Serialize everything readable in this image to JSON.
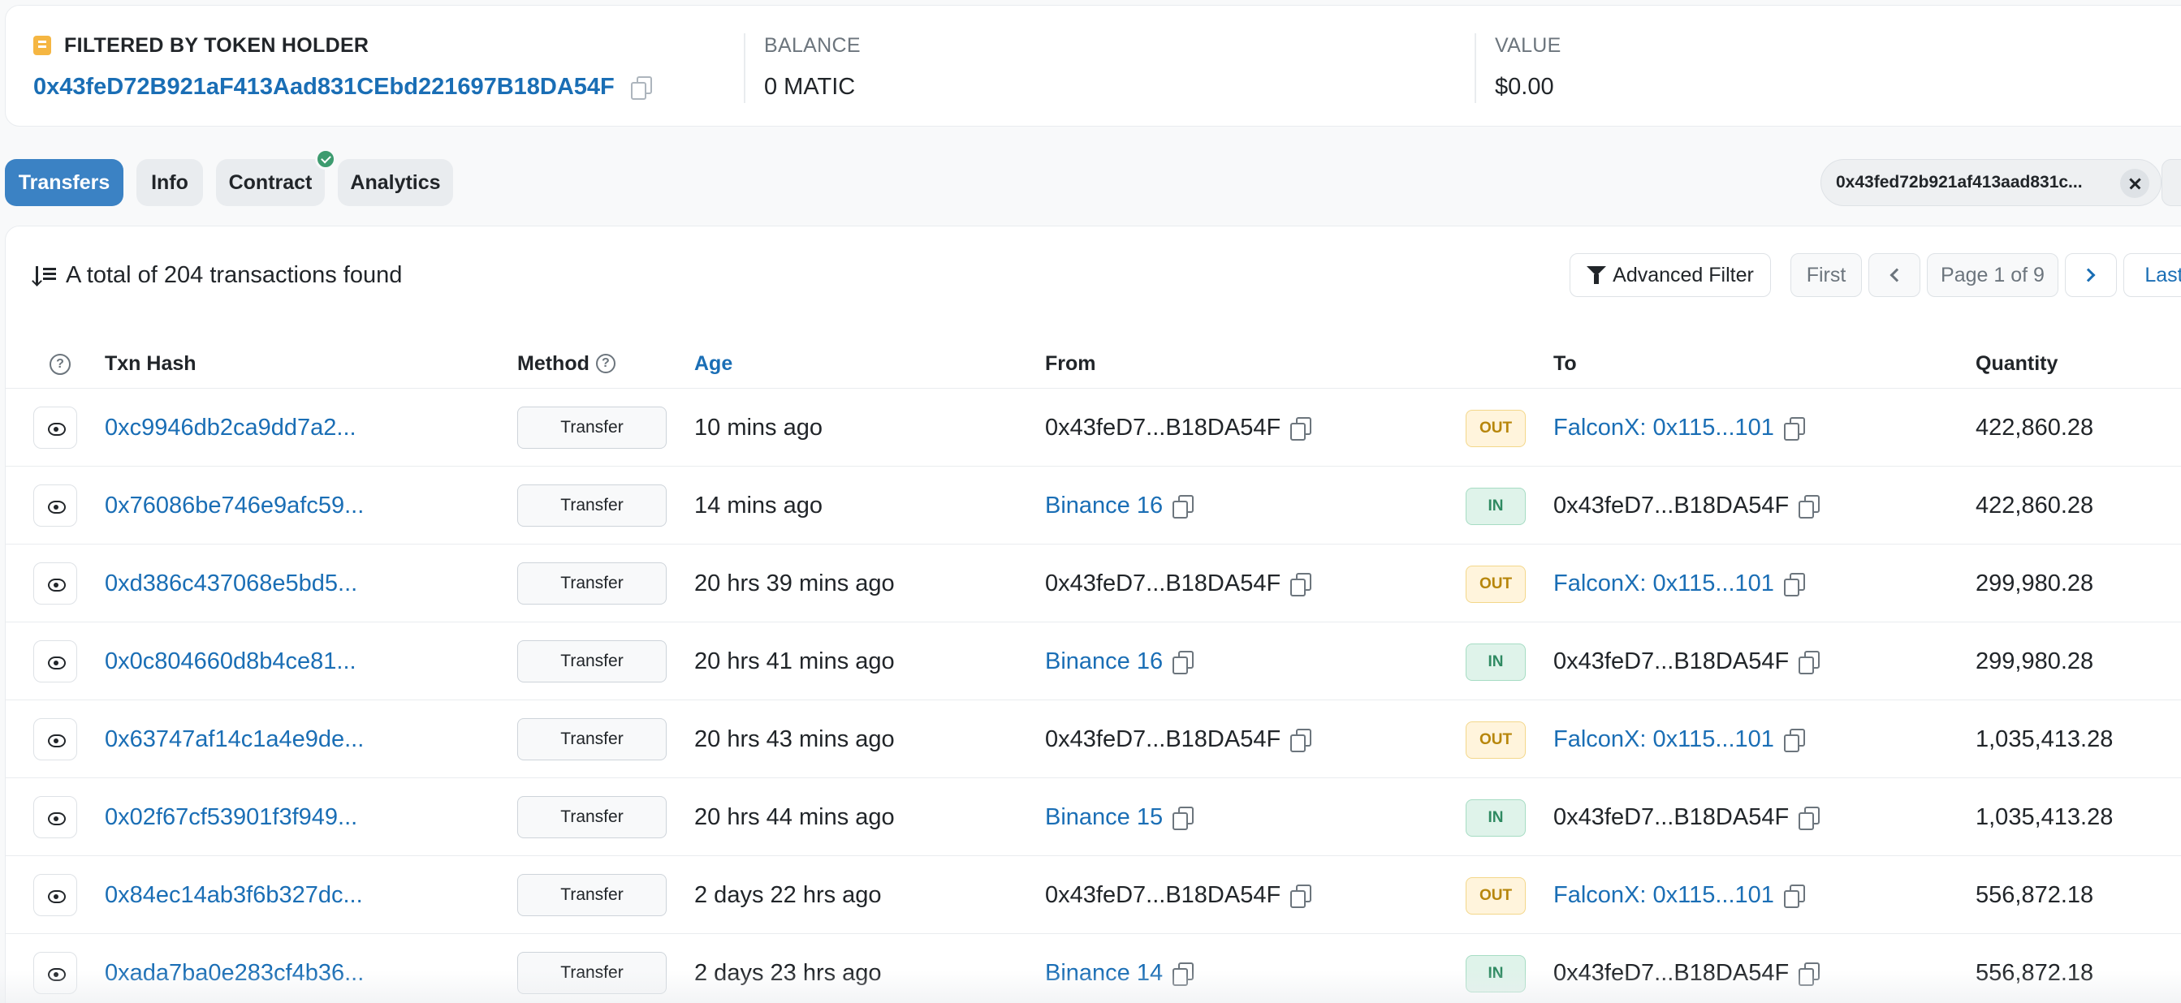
{
  "summary": {
    "holder_label": "FILTERED BY TOKEN HOLDER",
    "holder_address": "0x43feD72B921aF413Aad831CEbd221697B18DA54F",
    "balance_label": "BALANCE",
    "balance_value": "0 MATIC",
    "value_label": "VALUE",
    "value_value": "$0.00"
  },
  "tabs": [
    "Transfers",
    "Info",
    "Contract",
    "Analytics"
  ],
  "filter_chip": "0x43fed72b921af413aad831c...",
  "table": {
    "total_text": "A total of 204 transactions found",
    "advanced_filter": "Advanced Filter",
    "pager": {
      "first": "First",
      "page": "Page 1 of 9",
      "last": "Last"
    },
    "headers": {
      "hash": "Txn Hash",
      "method": "Method",
      "age": "Age",
      "from": "From",
      "to": "To",
      "quantity": "Quantity"
    },
    "rows": [
      {
        "hash": "0xc9946db2ca9dd7a2...",
        "method": "Transfer",
        "age": "10 mins ago",
        "from": "0x43feD7...B18DA54F",
        "from_link": false,
        "dir": "OUT",
        "to": "FalconX: 0x115...101",
        "to_link": true,
        "qty": "422,860.28"
      },
      {
        "hash": "0x76086be746e9afc59...",
        "method": "Transfer",
        "age": "14 mins ago",
        "from": "Binance 16",
        "from_link": true,
        "dir": "IN",
        "to": "0x43feD7...B18DA54F",
        "to_link": false,
        "qty": "422,860.28"
      },
      {
        "hash": "0xd386c437068e5bd5...",
        "method": "Transfer",
        "age": "20 hrs 39 mins ago",
        "from": "0x43feD7...B18DA54F",
        "from_link": false,
        "dir": "OUT",
        "to": "FalconX: 0x115...101",
        "to_link": true,
        "qty": "299,980.28"
      },
      {
        "hash": "0x0c804660d8b4ce81...",
        "method": "Transfer",
        "age": "20 hrs 41 mins ago",
        "from": "Binance 16",
        "from_link": true,
        "dir": "IN",
        "to": "0x43feD7...B18DA54F",
        "to_link": false,
        "qty": "299,980.28"
      },
      {
        "hash": "0x63747af14c1a4e9de...",
        "method": "Transfer",
        "age": "20 hrs 43 mins ago",
        "from": "0x43feD7...B18DA54F",
        "from_link": false,
        "dir": "OUT",
        "to": "FalconX: 0x115...101",
        "to_link": true,
        "qty": "1,035,413.28"
      },
      {
        "hash": "0x02f67cf53901f3f949...",
        "method": "Transfer",
        "age": "20 hrs 44 mins ago",
        "from": "Binance 15",
        "from_link": true,
        "dir": "IN",
        "to": "0x43feD7...B18DA54F",
        "to_link": false,
        "qty": "1,035,413.28"
      },
      {
        "hash": "0x84ec14ab3f6b327dc...",
        "method": "Transfer",
        "age": "2 days 22 hrs ago",
        "from": "0x43feD7...B18DA54F",
        "from_link": false,
        "dir": "OUT",
        "to": "FalconX: 0x115...101",
        "to_link": true,
        "qty": "556,872.18"
      },
      {
        "hash": "0xada7ba0e283cf4b36...",
        "method": "Transfer",
        "age": "2 days 23 hrs ago",
        "from": "Binance 14",
        "from_link": true,
        "dir": "IN",
        "to": "0x43feD7...B18DA54F",
        "to_link": false,
        "qty": "556,872.18"
      }
    ]
  }
}
